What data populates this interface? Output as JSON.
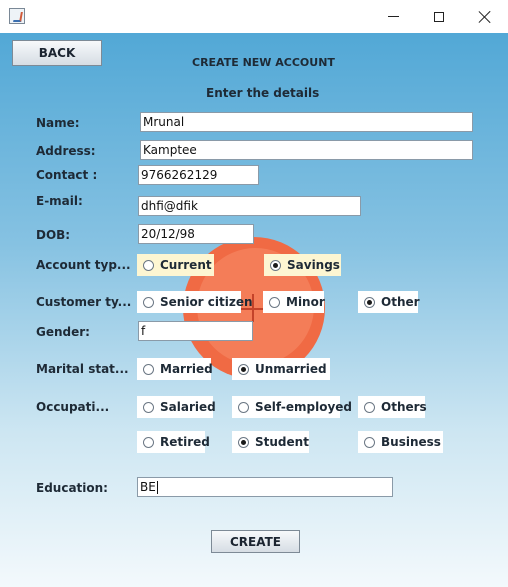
{
  "window": {
    "icon": "java-icon",
    "controls": [
      "minimize-icon",
      "maximize-icon",
      "close-icon"
    ]
  },
  "buttons": {
    "back": "BACK",
    "create": "CREATE"
  },
  "header": {
    "title": "CREATE NEW ACCOUNT",
    "subtitle": "Enter the details"
  },
  "labels": {
    "name": "Name:",
    "address": "Address:",
    "contact": "Contact :",
    "email": "E-mail:",
    "dob": "DOB:",
    "account_type": "Account typ...",
    "customer_type": "Customer ty...",
    "gender": "Gender:",
    "marital_status": "Marital stat...",
    "occupation": "Occupati...",
    "education": "Education:"
  },
  "fields": {
    "name": "Mrunal",
    "address": "Kamptee",
    "contact": "9766262129",
    "email": "dhfi@dfik",
    "dob": "20/12/98",
    "gender": "f",
    "education": "BE"
  },
  "account_type": {
    "current": "Current",
    "savings": "Savings",
    "selected": "Savings"
  },
  "customer_type": {
    "senior": "Senior citizen",
    "minor": "Minor",
    "other": "Other",
    "selected": "Other"
  },
  "marital": {
    "married": "Married",
    "unmarried": "Unmarried",
    "selected": "Unmarried"
  },
  "occupation": {
    "salaried": "Salaried",
    "self_employed": "Self-employed",
    "others": "Others",
    "retired": "Retired",
    "student": "Student",
    "business": "Business",
    "selected": "Student"
  },
  "colors": {
    "logo": "#f06a44",
    "background_top": "#52a8d6",
    "background_bottom": "#f3f9fc"
  }
}
